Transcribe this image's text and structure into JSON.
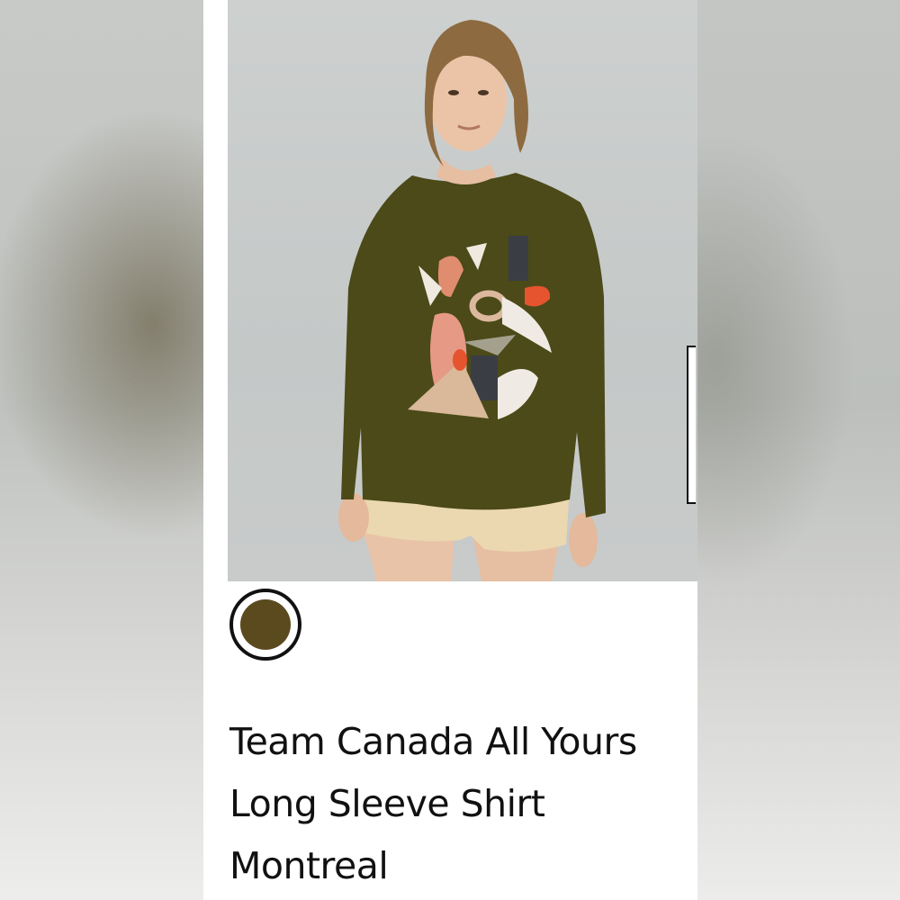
{
  "product": {
    "title_lines": [
      "Team Canada All Yours",
      "Long Sleeve Shirt",
      "Montreal"
    ],
    "image_alt": "Model wearing green long sleeve shirt with abstract graphic print"
  },
  "swatches": [
    {
      "name": "olive",
      "color": "#5a4a1e",
      "selected": true
    }
  ],
  "colors": {
    "shirt": "#4b4a18",
    "background": "#c8cbca",
    "shorts": "#ead7b0"
  }
}
